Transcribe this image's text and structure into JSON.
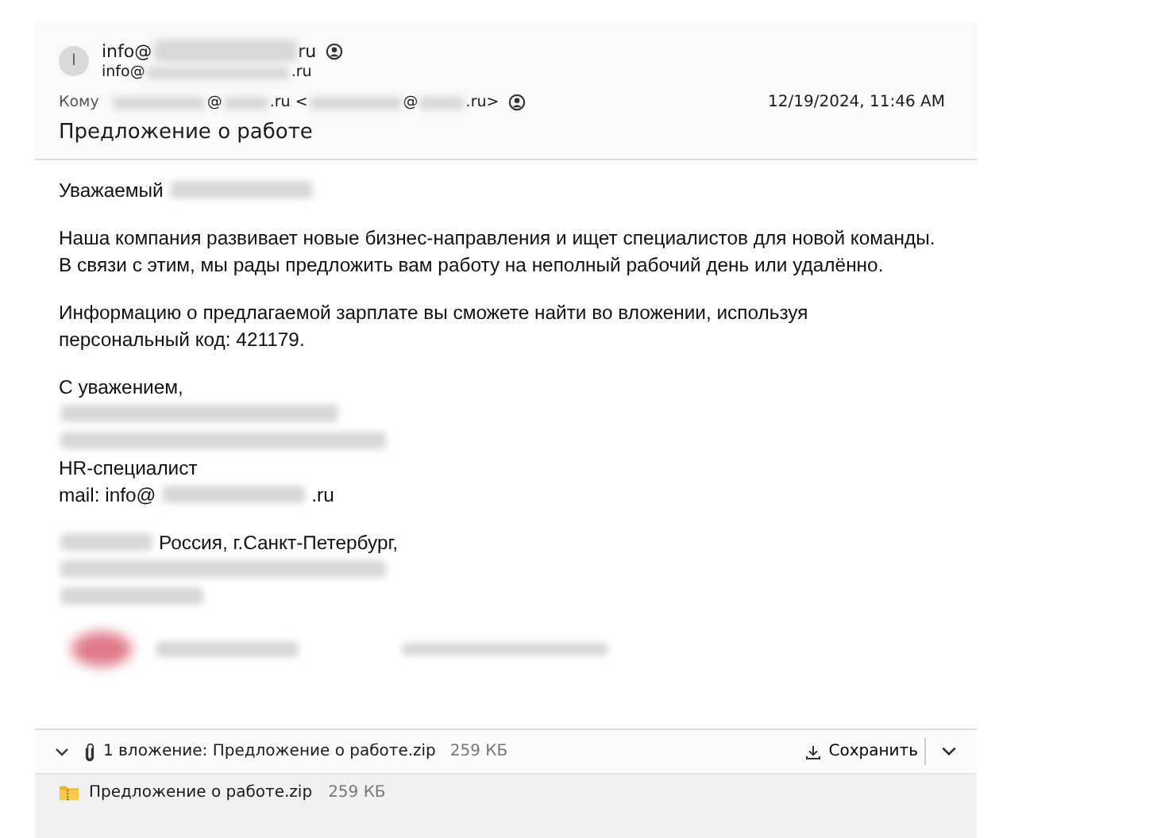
{
  "header": {
    "avatar_initial": "I",
    "from": [
      {
        "kind": "text",
        "text": "info@"
      },
      {
        "kind": "redacted"
      },
      {
        "kind": "text",
        "text": "ru"
      }
    ],
    "from_address": [
      {
        "kind": "text",
        "text": "info@"
      },
      {
        "kind": "redacted"
      },
      {
        "kind": "text",
        "text": ".ru"
      }
    ],
    "to_label": "Кому",
    "to": [
      {
        "kind": "redacted"
      },
      {
        "kind": "text",
        "text": "@"
      },
      {
        "kind": "redacted"
      },
      {
        "kind": "text",
        "text": ".ru <"
      },
      {
        "kind": "redacted"
      },
      {
        "kind": "text",
        "text": "@"
      },
      {
        "kind": "redacted"
      },
      {
        "kind": "text",
        "text": ".ru>"
      }
    ],
    "date": "12/19/2024, 11:46 AM",
    "subject": "Предложение о работе"
  },
  "body": [
    {
      "kind": "line",
      "segments": [
        {
          "kind": "text",
          "text": "Уважаемый"
        },
        {
          "kind": "redacted"
        }
      ]
    },
    {
      "kind": "blank"
    },
    {
      "kind": "line",
      "segments": [
        {
          "kind": "text",
          "text": "Наша компания развивает новые бизнес-направления и ищет специалистов для новой команды."
        }
      ]
    },
    {
      "kind": "line",
      "segments": [
        {
          "kind": "text",
          "text": "В связи с этим, мы рады предложить вам работу на неполный рабочий день или удалённо."
        }
      ]
    },
    {
      "kind": "blank"
    },
    {
      "kind": "line",
      "segments": [
        {
          "kind": "text",
          "text": "Информацию о предлагаемой зарплате вы сможете найти во вложении, используя"
        }
      ]
    },
    {
      "kind": "line",
      "segments": [
        {
          "kind": "text",
          "text": "персональный код: 421179."
        }
      ]
    },
    {
      "kind": "blank"
    },
    {
      "kind": "line",
      "segments": [
        {
          "kind": "text",
          "text": "С уважением,"
        }
      ]
    },
    {
      "kind": "line",
      "segments": [
        {
          "kind": "redacted"
        }
      ]
    },
    {
      "kind": "line",
      "segments": [
        {
          "kind": "redacted"
        }
      ]
    },
    {
      "kind": "line",
      "segments": [
        {
          "kind": "text",
          "text": "HR-специалист"
        }
      ]
    },
    {
      "kind": "line",
      "segments": [
        {
          "kind": "text",
          "text": "mail: info@"
        },
        {
          "kind": "redacted"
        },
        {
          "kind": "text",
          "text": ".ru"
        }
      ]
    },
    {
      "kind": "blank"
    },
    {
      "kind": "line",
      "segments": [
        {
          "kind": "redacted"
        },
        {
          "kind": "text",
          "text": "Россия, г.Санкт-Петербург,"
        }
      ]
    },
    {
      "kind": "line",
      "segments": [
        {
          "kind": "redacted"
        }
      ]
    },
    {
      "kind": "line",
      "segments": [
        {
          "kind": "redacted"
        }
      ]
    },
    {
      "kind": "logo"
    }
  ],
  "attachments": {
    "expanded": true,
    "summary": "1 вложение: Предложение о работе.zip",
    "size": "259 КБ",
    "save_label": "Сохранить",
    "files": [
      {
        "name": "Предложение о работе.zip",
        "size": "259 КБ"
      }
    ]
  }
}
